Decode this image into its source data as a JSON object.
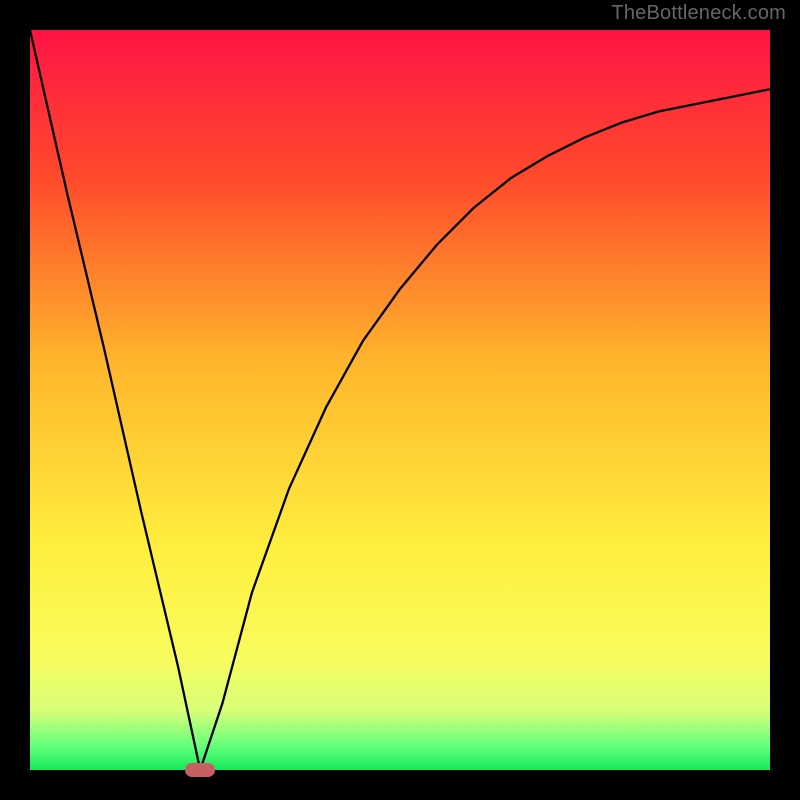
{
  "watermark": "TheBottleneck.com",
  "chart_data": {
    "type": "line",
    "title": "",
    "xlabel": "",
    "ylabel": "",
    "xlim": [
      0,
      100
    ],
    "ylim": [
      0,
      100
    ],
    "gradient_stops": [
      {
        "offset": 0,
        "color": "#ff1445"
      },
      {
        "offset": 20,
        "color": "#ff4a2b"
      },
      {
        "offset": 45,
        "color": "#ffb62c"
      },
      {
        "offset": 70,
        "color": "#ffef3e"
      },
      {
        "offset": 85,
        "color": "#f8fc5e"
      },
      {
        "offset": 92,
        "color": "#d8ff7a"
      },
      {
        "offset": 97,
        "color": "#5dff7a"
      },
      {
        "offset": 100,
        "color": "#16e85a"
      }
    ],
    "series": [
      {
        "name": "curve",
        "x": [
          0,
          5,
          10,
          15,
          20,
          23,
          26,
          30,
          35,
          40,
          45,
          50,
          55,
          60,
          65,
          70,
          75,
          80,
          85,
          90,
          95,
          100
        ],
        "y": [
          100,
          78,
          57,
          35,
          14,
          0,
          9,
          24,
          38,
          49,
          58,
          65,
          71,
          76,
          80,
          83,
          85.5,
          87.5,
          89,
          90,
          91,
          92
        ]
      }
    ],
    "marker": {
      "x": 23,
      "y": 0,
      "color": "#c86062"
    }
  }
}
